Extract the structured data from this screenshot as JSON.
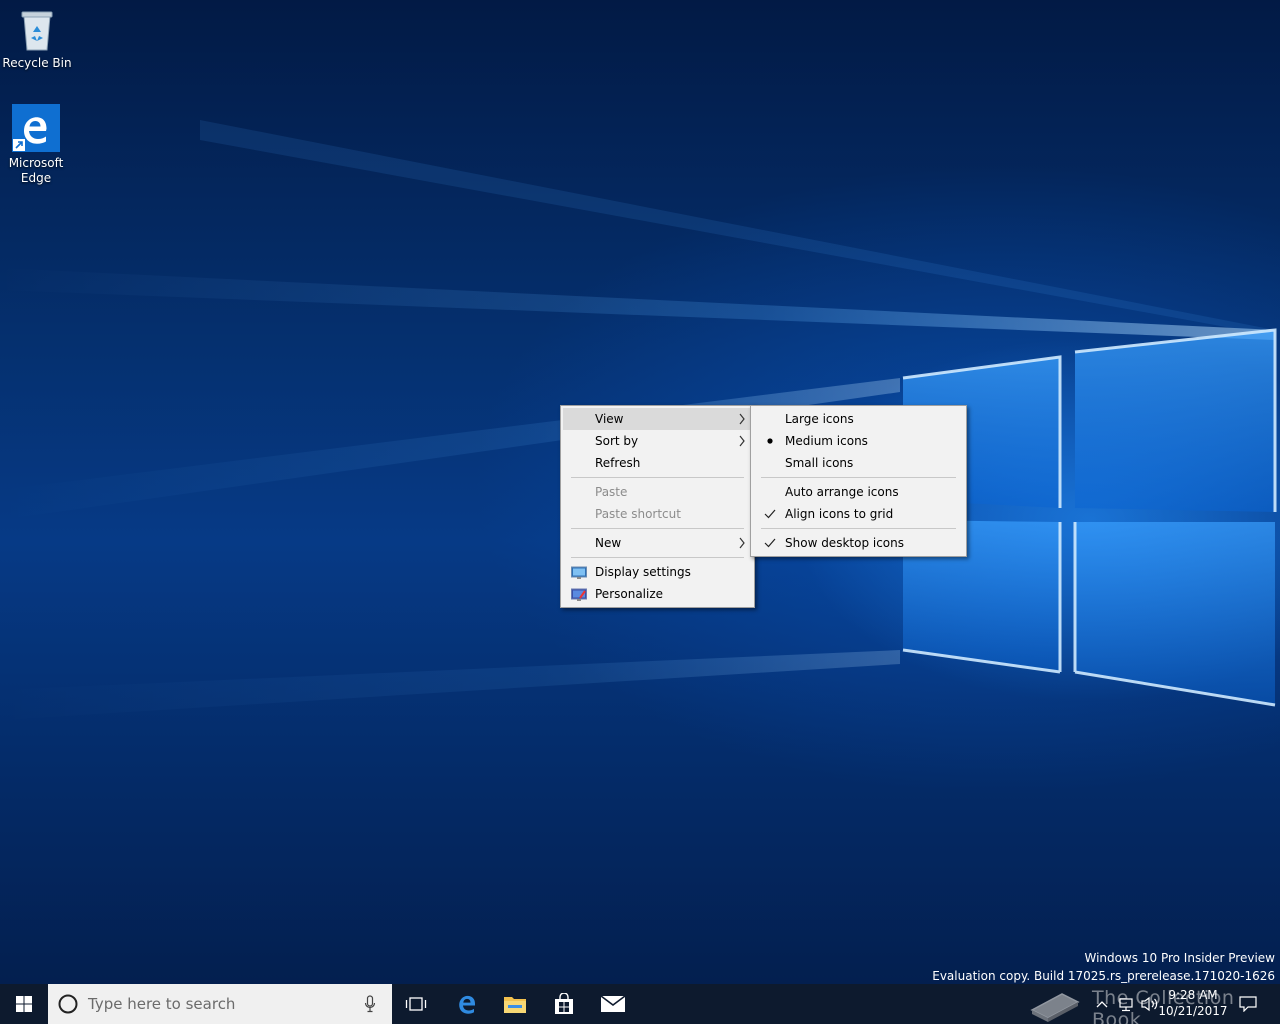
{
  "desktop": {
    "icons": [
      {
        "label": "Recycle Bin",
        "icon": "recycle-bin-icon"
      },
      {
        "label": "Microsoft\nEdge",
        "icon": "edge-icon"
      }
    ]
  },
  "context_menu": {
    "items": [
      {
        "label": "View",
        "submenu": true,
        "highlighted": true
      },
      {
        "label": "Sort by",
        "submenu": true
      },
      {
        "label": "Refresh"
      },
      {
        "label": "Paste",
        "disabled": true
      },
      {
        "label": "Paste shortcut",
        "disabled": true
      },
      {
        "label": "New",
        "submenu": true
      },
      {
        "label": "Display settings",
        "icon": "display-icon"
      },
      {
        "label": "Personalize",
        "icon": "personalize-icon"
      }
    ]
  },
  "view_submenu": {
    "items": [
      {
        "label": "Large icons",
        "mark": "none"
      },
      {
        "label": "Medium icons",
        "mark": "bullet"
      },
      {
        "label": "Small icons",
        "mark": "none"
      },
      {
        "label": "Auto arrange icons",
        "mark": "none"
      },
      {
        "label": "Align icons to grid",
        "mark": "check"
      },
      {
        "label": "Show desktop icons",
        "mark": "check"
      }
    ]
  },
  "watermark": {
    "line1": "Windows 10 Pro Insider Preview",
    "line2": "Evaluation copy. Build 17025.rs_prerelease.171020-1626"
  },
  "taskbar": {
    "search_placeholder": "Type here to search",
    "pinned": [
      "edge-icon",
      "file-explorer-icon",
      "store-icon",
      "mail-icon"
    ],
    "clock_time": "9:28 AM",
    "clock_date": "10/21/2017",
    "overlay_text": "The Collection Book"
  },
  "colors": {
    "menu_bg": "#f2f2f2",
    "menu_highlight": "#dadada",
    "taskbar_bg": "#0d1a2e",
    "accent": "#0078d7"
  }
}
